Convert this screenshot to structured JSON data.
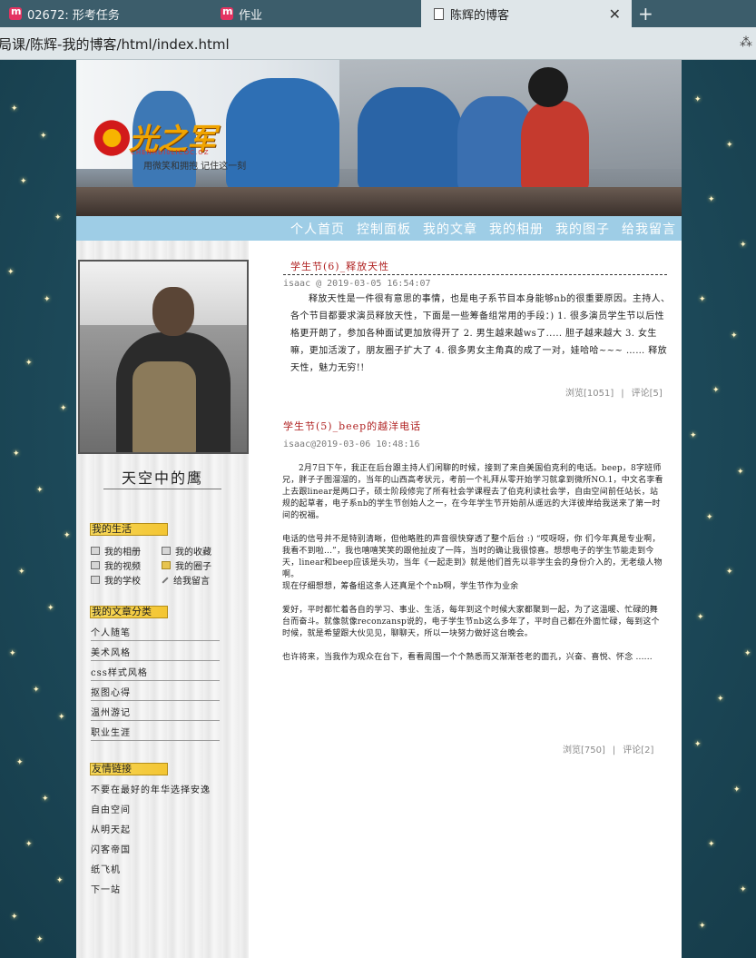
{
  "browser": {
    "tabs": [
      {
        "label": "02672: 形考任务"
      },
      {
        "label": "作业"
      },
      {
        "label": "陈辉的博客"
      }
    ],
    "address": "局课/陈辉-我的博客/html/index.html"
  },
  "banner": {
    "logo_text": "光之军",
    "logo_sub": "CHENHUI0LICOC.OZ",
    "tagline": "用微笑和拥抱 记住这一刻"
  },
  "nav": [
    "个人首页",
    "控制面板",
    "我的文章",
    "我的相册",
    "我的图子",
    "给我留言"
  ],
  "sidebar": {
    "nickname": "天空中的鹰",
    "life_title": "我的生活",
    "life_items": [
      "我的相册",
      "我的收藏",
      "我的视频",
      "我的圈子",
      "我的学校",
      "给我留言"
    ],
    "category_title": "我的文章分类",
    "categories": [
      "个人随笔",
      "美术风格",
      "css样式风格",
      "抠图心得",
      "温州游记",
      "职业生涯"
    ],
    "links_title": "友情链接",
    "links": [
      "不要在最好的年华选择安逸",
      "自由空间",
      "从明天起",
      "闪客帝国",
      "纸飞机",
      "下一站"
    ]
  },
  "posts": [
    {
      "title": "学生节(6)_释放天性",
      "meta": "isaac @ 2019-03-05 16:54:07",
      "body": "释放天性是一件很有意思的事情，也是电子系节目本身能够nb的很重要原因。主持人、各个节目都要求演员释放天性，下面是一些筹备组常用的手段：) 1. 很多演员学生节以后性格更开朗了，参加各种面试更加放得开了 2. 男生越来越ws了..... 胆子越来越大 3. 女生嘛，更加活泼了，朋友圈子扩大了 4. 很多男女主角真的成了一对，娃哈哈~~~ …… 释放天性，魅力无穷!!",
      "views": "浏览[1051]",
      "comments": "评论[5]"
    },
    {
      "title": "学生节(5)_beep的越洋电话",
      "meta": "isaac@2019-03-06 10:48:16",
      "paragraphs": [
        "2月7日下午，我正在后台跟主持人们闲聊的时候，接到了来自美国伯克利的电话。beep，8字班师兄，胖子子图溜溜的，当年的山西高考状元，考前一个礼拜从零开始学习就拿到微所NO.1，中文名李看上去跟linear是两口子，硕士阶段修完了所有社会学课程去了伯克利读社会学，自由空间前任站长，站规的起草者，电子系nb的学生节创始人之一，在今年学生节开始前从遥远的大洋彼岸给我送来了第一时间的祝福。",
        "电话的信号并不是特别清晰，但他略胜的声音很快穿透了整个后台 :) “哎呀呀，你 们今年真是专业啊，我看不到啦...”，我也嘻嘻笑笑的跟他扯皮了一阵，当时的确让我很惊喜。想想电子的学生节能走到今天，linear和beep应该是头功，当年《一起走到》就是他们首先以非学生会的身份介入的，无老级人物啊。",
        "现在仔细想想，筹备组这条人还真是个个nb啊，学生节作为业余",
        "爱好，平时都忙着各自的学习、事业、生活，每年到这个时候大家都聚到一起，为了这温暖、忙碌的舞台而奋斗。就像就像reconzansp说的，电子学生节nb这么多年了，平时自己都在外面忙碌，每到这个时候，就是希望跟大伙见见，聊聊天，所以一块努力做好这台晚会。",
        "也许将来，当我作为观众在台下，看看周围一个个熟悉而又渐渐苍老的面孔，兴奋、喜悦、怀念 ......"
      ],
      "views": "浏览[750]",
      "comments": "评论[2]"
    }
  ],
  "colors": {
    "nav_bg": "#9ecde6",
    "post_title": "#b02222",
    "section_badge": "#f3c532",
    "page_bg": "#1f4e5e"
  }
}
